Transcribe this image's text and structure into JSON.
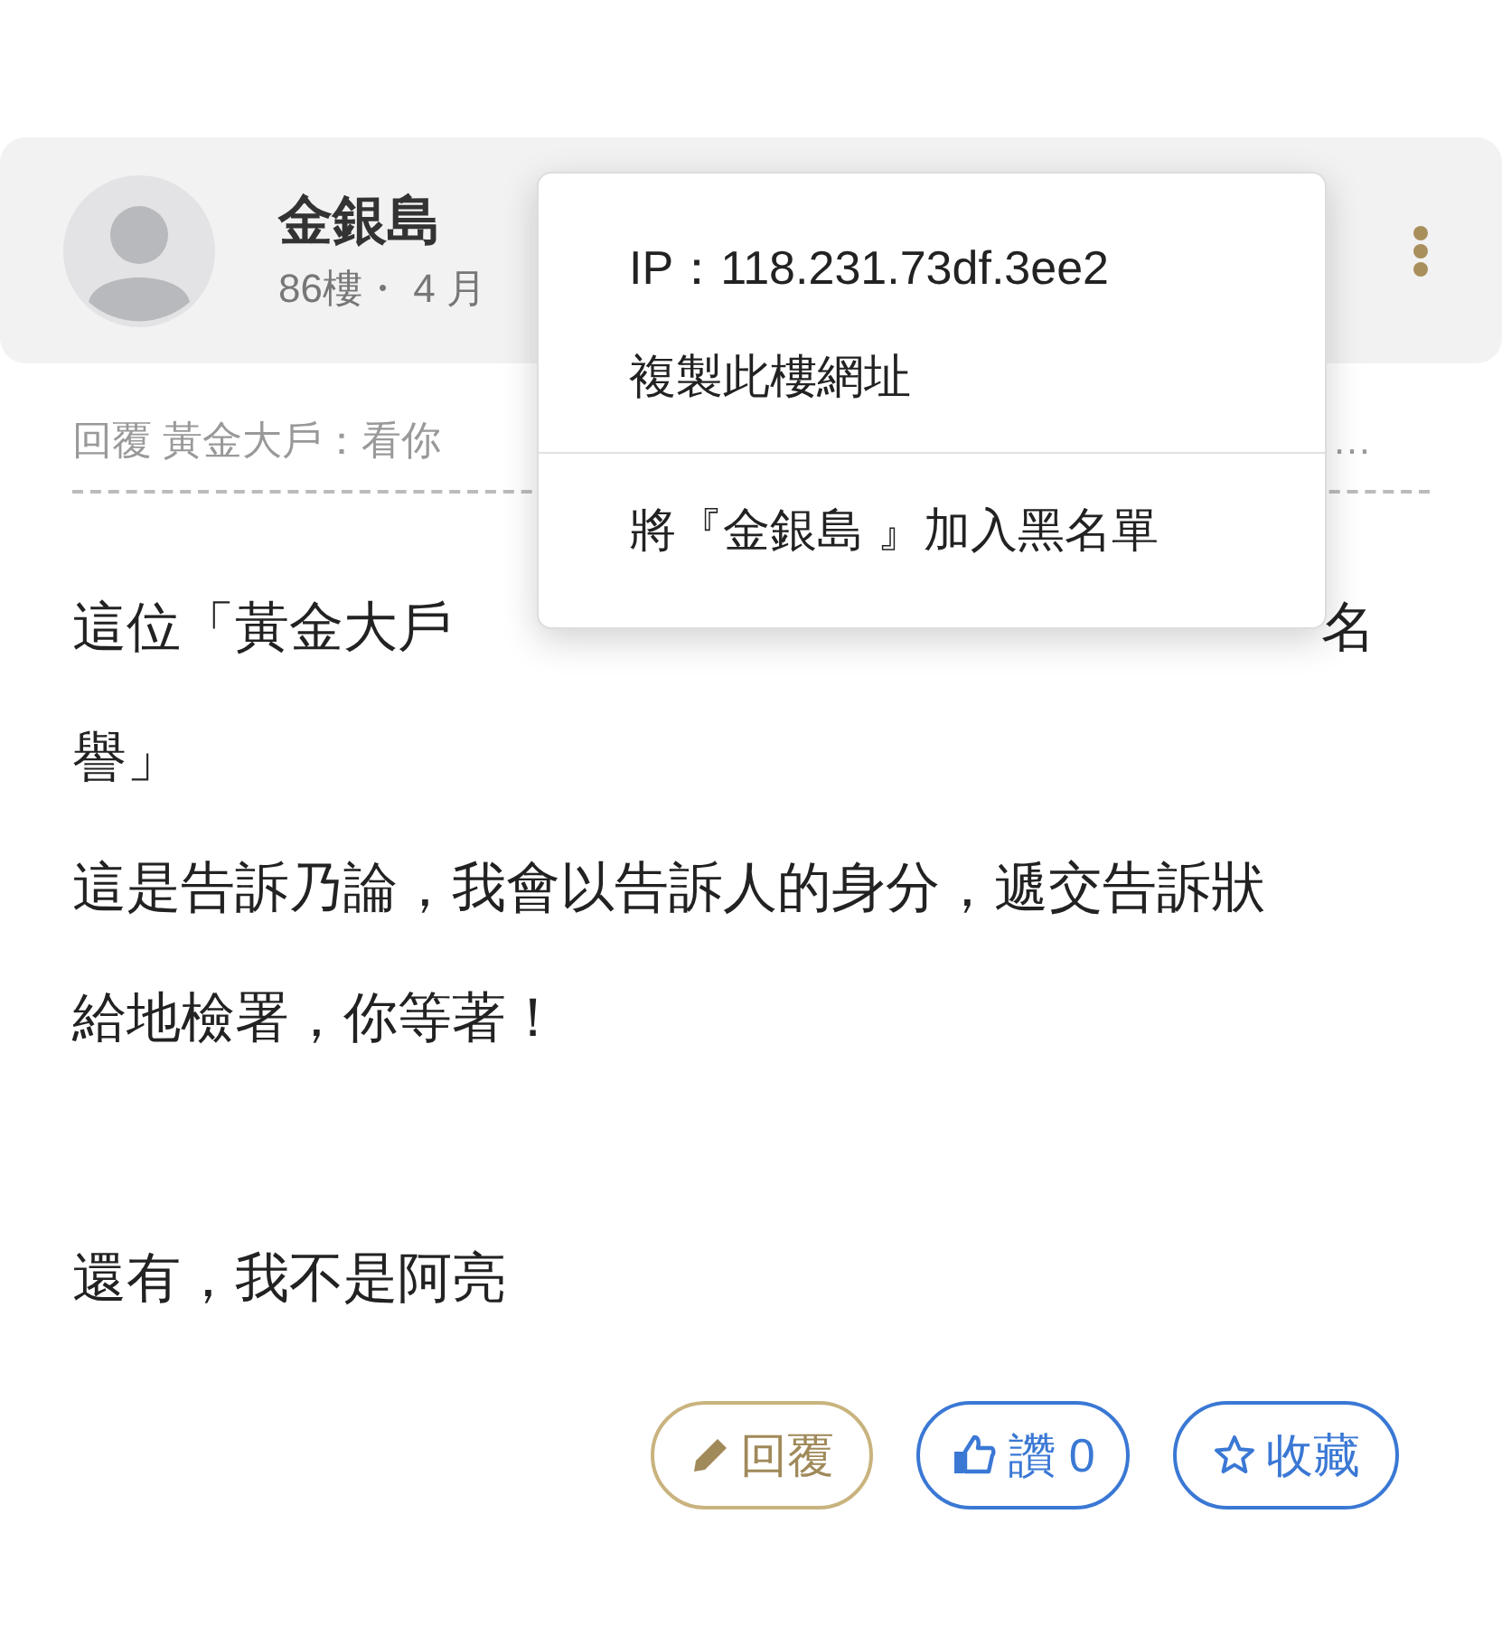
{
  "post": {
    "author": "金銀島",
    "meta": "86樓・ 4 月",
    "quote": {
      "text": "回覆 黃金大戶：看你",
      "tail": "…"
    },
    "body": [
      {
        "kind": "split",
        "left": "這位「黃金大戶",
        "right": "名"
      },
      {
        "kind": "line",
        "text": "譽」"
      },
      {
        "kind": "line",
        "text": "這是告訴乃論，我會以告訴人的身分，遞交告訴狀"
      },
      {
        "kind": "line",
        "text": "給地檢署，你等著！"
      },
      {
        "kind": "blank"
      },
      {
        "kind": "line",
        "text": "還有，我不是阿亮"
      }
    ],
    "actions": [
      {
        "kind": "reply",
        "label": "回覆"
      },
      {
        "kind": "like",
        "label": "讚 0"
      },
      {
        "kind": "collect",
        "label": "收藏"
      }
    ]
  },
  "menu": {
    "items": [
      {
        "kind": "item",
        "label": "IP：118.231.73df.3ee2"
      },
      {
        "kind": "item",
        "label": "複製此樓網址"
      },
      {
        "kind": "divider"
      },
      {
        "kind": "item",
        "label": "將『金銀島 』加入黑名單"
      }
    ]
  }
}
